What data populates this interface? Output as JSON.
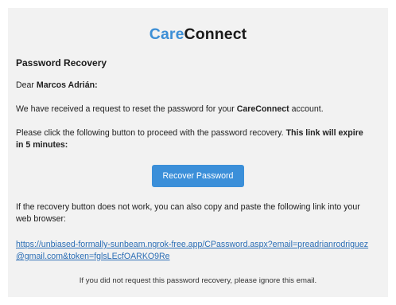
{
  "brand": {
    "part1": "Care",
    "part2": "Connect"
  },
  "title": "Password Recovery",
  "greeting": {
    "prefix": "Dear ",
    "name": "Marcos Adrián:"
  },
  "intro": {
    "before": "We have received a request to reset the password for your ",
    "brand": "CareConnect",
    "after": " account."
  },
  "instruction": {
    "text": "Please click the following button to proceed with the password recovery. ",
    "bold": "This link will expire in 5 minutes:"
  },
  "button": {
    "label": "Recover Password"
  },
  "fallback_text": "If the recovery button does not work, you can also copy and paste the following link into your web browser:",
  "recovery_link": "https://unbiased-formally-sunbeam.ngrok-free.app/CPassword.aspx?email=preadrianrodriguez@gmail.com&token=fglsLEcfOARKO9Re",
  "footer_note": "If you did not request this password recovery, please ignore this email.",
  "colors": {
    "brand_blue": "#3d8fd6",
    "button_blue": "#3b8fd9",
    "link": "#2a6db5",
    "card_bg": "#f2f2f2"
  }
}
